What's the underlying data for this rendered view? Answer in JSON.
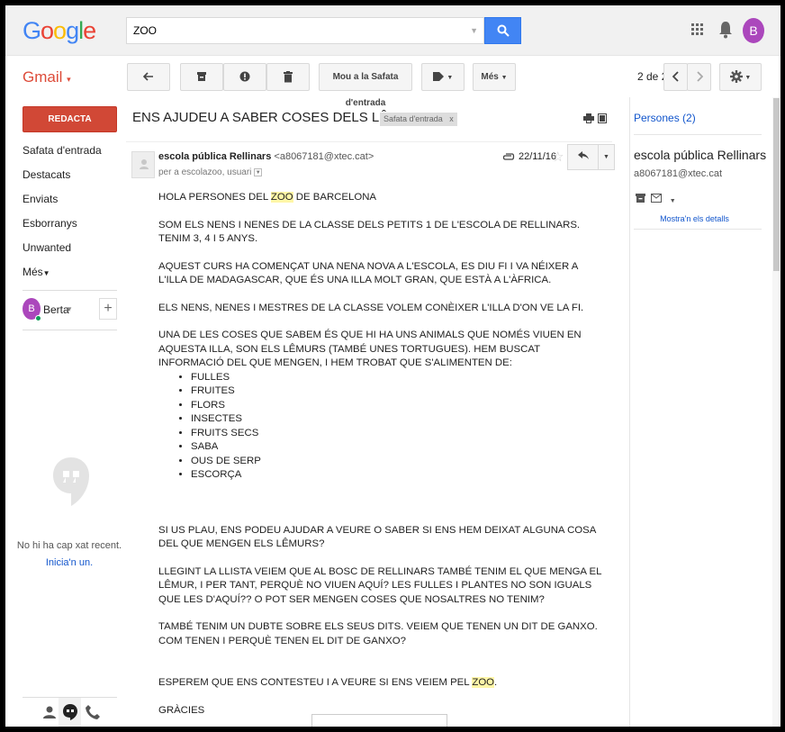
{
  "header": {
    "logo_text": "Google",
    "search_value": "ZOO",
    "avatar_letter": "B"
  },
  "toolbar": {
    "app_label": "Gmail",
    "move_to_inbox_label": "Mou a la Safata d'entrada",
    "more_label": "Més",
    "pager_text": "2 de 2"
  },
  "sidebar": {
    "compose_label": "REDACTA",
    "items": [
      {
        "label": "Safata d'entrada"
      },
      {
        "label": "Destacats"
      },
      {
        "label": "Enviats"
      },
      {
        "label": "Esborranys"
      },
      {
        "label": "Unwanted"
      },
      {
        "label": "Més"
      }
    ],
    "chat_user_letter": "B",
    "chat_user_name": "Berta",
    "no_recent_chats": "No hi ha cap xat recent.",
    "start_chat_link": "Inicia'n un."
  },
  "message": {
    "subject": "ENS AJUDEU A SABER COSES DELS LÊMURS?",
    "label_tag": "Safata d'entrada",
    "label_close": "x",
    "sender_name": "escola pública Rellinars",
    "sender_email": "<a8067181@xtec.cat>",
    "recipients": "per a escolazoo, usuari",
    "date": "22/11/16",
    "body": {
      "greeting_pre": "HOLA PERSONES DEL ",
      "greeting_hl": "ZOO",
      "greeting_post": " DE BARCELONA",
      "p1": "SOM ELS NENS I NENES DE LA CLASSE DELS PETITS 1 DE L'ESCOLA DE RELLINARS. TENIM 3, 4 I 5 ANYS.",
      "p2": "AQUEST CURS HA COMENÇAT UNA NENA NOVA A L'ESCOLA, ES DIU FI I VA NÉIXER A L'ILLA DE MADAGASCAR, QUE ÉS UNA ILLA MOLT GRAN, QUE ESTÀ A L'ÀFRICA.",
      "p3": "ELS NENS, NENES I MESTRES DE LA CLASSE VOLEM CONÈIXER L'ILLA D'ON VE LA FI.",
      "p4": "UNA DE LES COSES QUE SABEM ÉS QUE HI HA UNS ANIMALS QUE NOMÉS VIUEN EN AQUESTA ILLA, SON ELS LÊMURS (TAMBÉ UNES TORTUGUES). HEM BUSCAT INFORMACIÓ DEL QUE MENGEN, I HEM TROBAT QUE S'ALIMENTEN  DE:",
      "foods": [
        "FULLES",
        "FRUITES",
        "FLORS",
        "INSECTES",
        "FRUITS SECS",
        "SABA",
        "OUS DE SERP",
        "ESCORÇA"
      ],
      "p5": "SI US PLAU, ENS PODEU AJUDAR A VEURE O SABER SI ENS HEM DEIXAT ALGUNA COSA DEL QUE MENGEN ELS LÊMURS?",
      "p6": "LLEGINT LA LLISTA VEIEM QUE AL BOSC DE RELLINARS TAMBÉ TENIM EL QUE MENGA EL LÊMUR, I PER TANT, PERQUÈ NO VIUEN AQUÍ? LES FULLES I PLANTES NO SON IGUALS QUE LES D'AQUÍ?? O POT SER MENGEN COSES QUE NOSALTRES NO TENIM?",
      "p7": "TAMBÉ TENIM UN DUBTE SOBRE ELS SEUS DITS. VEIEM QUE TENEN UN DIT DE GANXO. COM TENEN I PERQUÈ TENEN EL DIT DE GANXO?",
      "p8_pre": "ESPEREM QUE ENS CONTESTEU I A VEURE SI ENS VEIEM PEL ",
      "p8_hl": "ZOO",
      "p8_post": ".",
      "closing": "GRÀCIES"
    }
  },
  "people": {
    "title": "Persones (2)",
    "contact_name": "escola pública Rellinars",
    "contact_email": "a8067181@xtec.cat",
    "details_link": "Mostra'n els detalls"
  },
  "colors": {
    "compose_red": "#d14836",
    "search_blue": "#4285f4",
    "avatar_purple": "#ab47bc",
    "link_blue": "#1155cc",
    "highlight": "#fff6a7"
  }
}
